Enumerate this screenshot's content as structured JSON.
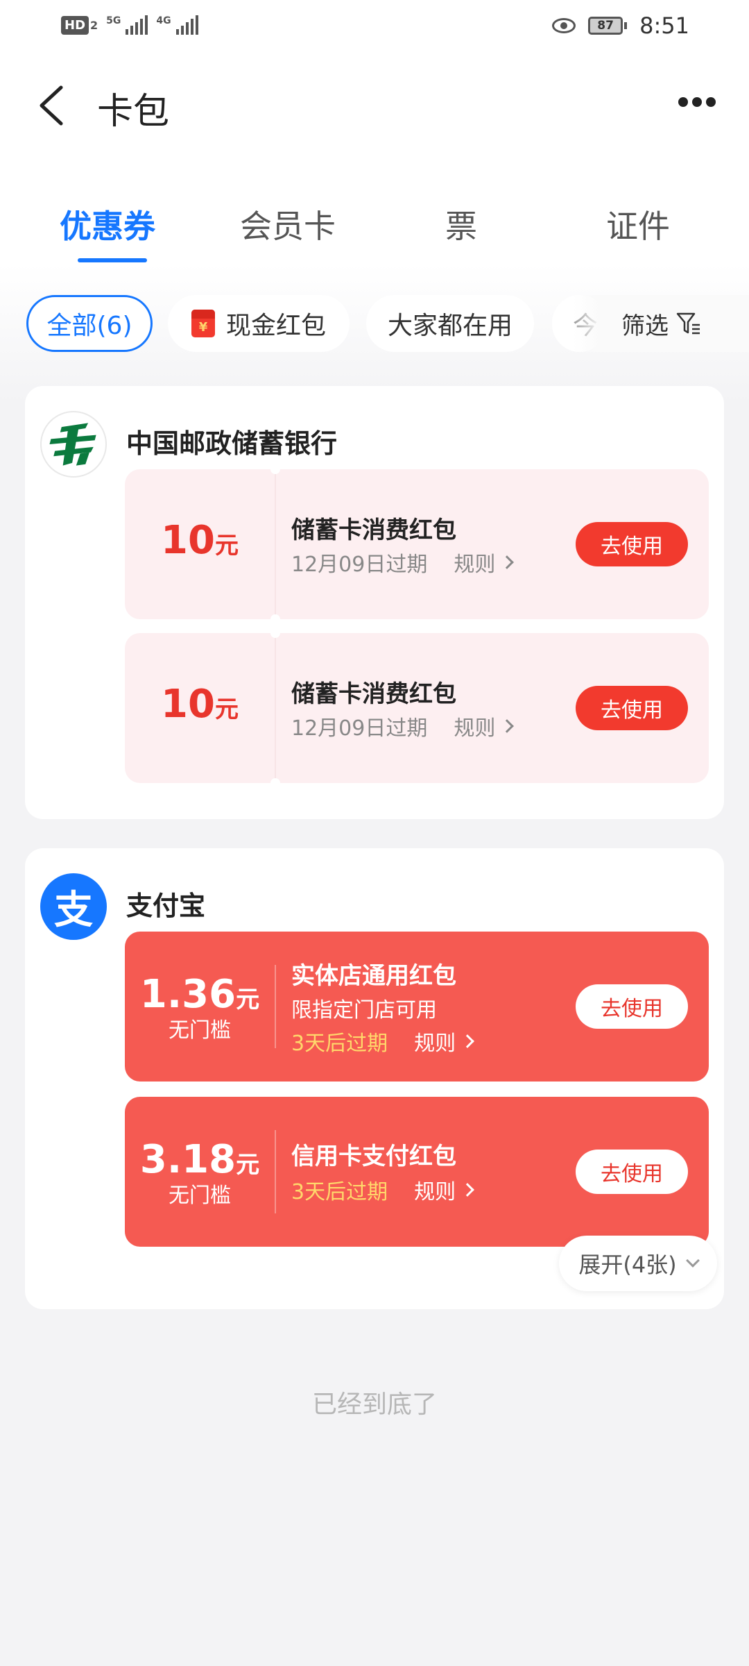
{
  "status_bar": {
    "hd_label": "HD",
    "hd_sub": "2",
    "network_1": "5G",
    "network_2": "4G",
    "battery": "87",
    "time": "8:51"
  },
  "header": {
    "title": "卡包"
  },
  "tabs": [
    {
      "label": "优惠券",
      "active": true
    },
    {
      "label": "会员卡",
      "active": false
    },
    {
      "label": "票",
      "active": false
    },
    {
      "label": "证件",
      "active": false
    }
  ],
  "chips": [
    {
      "label": "全部(6)",
      "active": true
    },
    {
      "label": "现金红包",
      "active": false,
      "icon": "red-packet-icon",
      "icon_glyph": "¥"
    },
    {
      "label": "大家都在用",
      "active": false
    },
    {
      "label": "今",
      "active": false
    }
  ],
  "filter_label": "筛选",
  "groups": [
    {
      "name": "中国邮政储蓄银行",
      "logo": "postal-savings-bank-logo",
      "coupons": [
        {
          "amount": "10",
          "unit": "元",
          "title": "储蓄卡消费红包",
          "expiry": "12月09日过期",
          "rule": "规则",
          "button": "去使用"
        },
        {
          "amount": "10",
          "unit": "元",
          "title": "储蓄卡消费红包",
          "expiry": "12月09日过期",
          "rule": "规则",
          "button": "去使用"
        }
      ]
    },
    {
      "name": "支付宝",
      "logo": "alipay-logo",
      "logo_glyph": "支",
      "coupons": [
        {
          "amount": "1.36",
          "unit": "元",
          "threshold": "无门槛",
          "title": "实体店通用红包",
          "desc": "限指定门店可用",
          "expiry": "3天后过期",
          "rule": "规则",
          "button": "去使用"
        },
        {
          "amount": "3.18",
          "unit": "元",
          "threshold": "无门槛",
          "title": "信用卡支付红包",
          "expiry": "3天后过期",
          "rule": "规则",
          "button": "去使用"
        }
      ],
      "expand_label": "展开(4张)"
    }
  ],
  "footer_text": "已经到底了",
  "colors": {
    "accent": "#1677ff",
    "coupon_red": "#f55a52",
    "coupon_pink": "#fdeff1",
    "button_red": "#f23a2e",
    "expiry_gold": "#ffd86b"
  }
}
